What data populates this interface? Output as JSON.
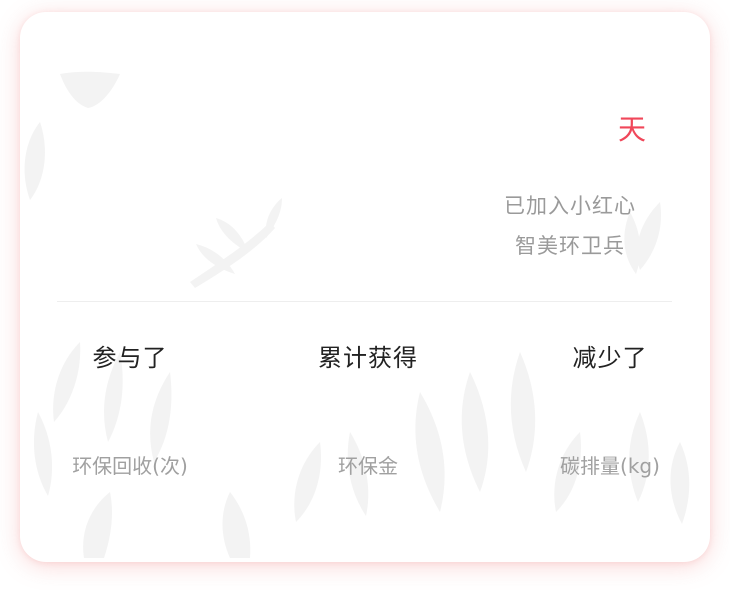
{
  "summary": {
    "days_unit": "天",
    "joined_line1": "已加入小红心",
    "joined_line2": "智美环卫兵"
  },
  "stats": [
    {
      "title": "参与了",
      "unit": "环保回收(次)"
    },
    {
      "title": "累计获得",
      "unit": "环保金"
    },
    {
      "title": "减少了",
      "unit": "碳排量(kg)"
    }
  ],
  "colors": {
    "accent": "#f0475a",
    "title_text": "#222222",
    "muted_text": "#9a9a9a",
    "leaf": "#f2f2f2"
  }
}
